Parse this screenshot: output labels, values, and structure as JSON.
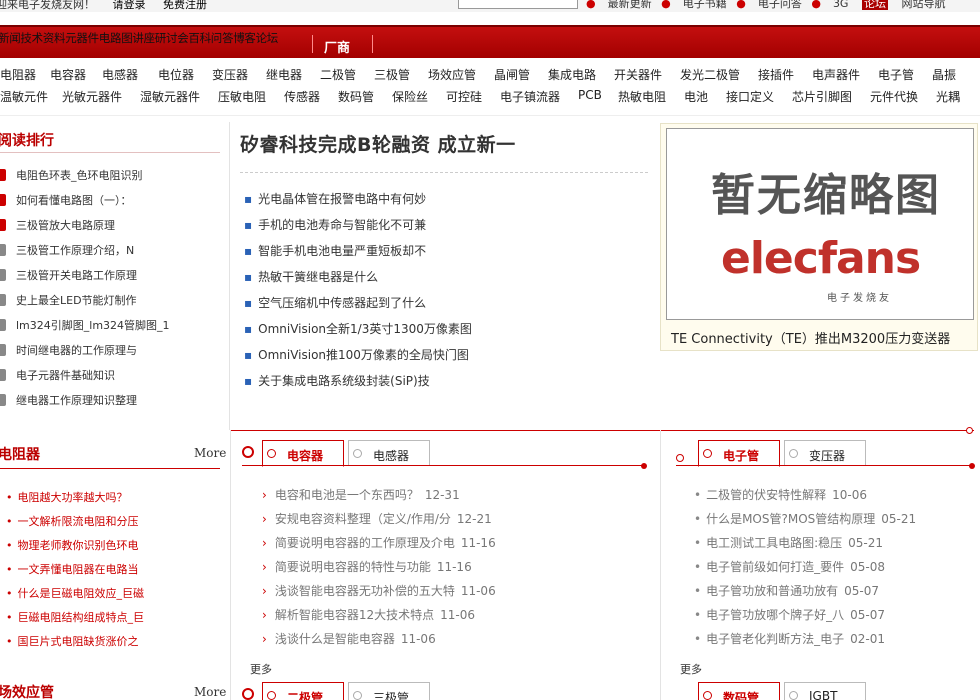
{
  "topbar": {
    "welcome": "迎来电子发烧友网！",
    "login": "请登录",
    "register": "免费注册",
    "links": [
      "最新更新",
      "电子书籍",
      "电子问答",
      "3G",
      "论坛",
      "网站导航"
    ]
  },
  "rednav": {
    "links": "新闻技术资料元器件电路图讲座研讨会百科问答博客论坛",
    "vendor": "厂商"
  },
  "categories": {
    "row1": [
      "电阻器",
      "电容器",
      "电感器",
      "电位器",
      "变压器",
      "继电器",
      "二极管",
      "三极管",
      "场效应管",
      "晶闸管",
      "集成电路",
      "开关器件",
      "发光二极管",
      "接插件",
      "电声器件",
      "电子管",
      "晶振"
    ],
    "row2": [
      "温敏元件",
      "光敏元器件",
      "湿敏元器件",
      "压敏电阻",
      "传感器",
      "数码管",
      "保险丝",
      "可控硅",
      "电子镇流器",
      "PCB",
      "热敏电阻",
      "电池",
      "接口定义",
      "芯片引脚图",
      "元件代换",
      "光耦"
    ]
  },
  "ranking": {
    "title": "阅读排行",
    "items": [
      "电阻色环表_色环电阻识别",
      "如何看懂电路图（一）：",
      "三极管放大电路原理",
      "三极管工作原理介绍，N",
      "三极管开关电路工作原理",
      "史上最全LED节能灯制作",
      "lm324引脚图_lm324管脚图_1",
      "时间继电器的工作原理与",
      "电子元器件基础知识",
      "继电器工作原理知识整理"
    ]
  },
  "headline": {
    "title": "矽睿科技完成B轮融资 成立新一",
    "news": [
      "光电晶体管在报警电路中有何妙",
      "手机的电池寿命与智能化不可兼",
      "智能手机电池电量严重短板却不",
      "热敏干簧继电器是什么",
      "空气压缩机中传感器起到了什么",
      "OmniVision全新1/3英寸1300万像素图",
      "OmniVision推100万像素的全局快门图",
      "关于集成电路系统级封装(SiP)技"
    ]
  },
  "feature": {
    "placeholder": "暂无缩略图",
    "logo": "elecfans",
    "logo_sub": "电子发烧友",
    "caption": "TE Connectivity（TE）推出M3200压力变送器"
  },
  "resistor_block": {
    "title": "电阻器",
    "more": "More",
    "items": [
      "电阻越大功率越大吗？",
      "一文解析限流电阻和分压",
      "物理老师教你识别色环电",
      "一文弄懂电阻器在电路当",
      "什么是巨磁电阻效应_巨磁",
      "巨磁电阻结构组成特点_巨",
      "国巨片式电阻缺货涨价之"
    ]
  },
  "fet_block": {
    "title": "场效应管",
    "more": "More"
  },
  "capacitor_tabs": {
    "tabs": [
      "电容器",
      "电感器"
    ],
    "items": [
      {
        "text": "电容和电池是一个东西吗？",
        "date": "12-31"
      },
      {
        "text": "安规电容资料整理（定义/作用/分",
        "date": "12-21"
      },
      {
        "text": "简要说明电容器的工作原理及介电",
        "date": "11-16"
      },
      {
        "text": "简要说明电容器的特性与功能",
        "date": "11-16"
      },
      {
        "text": "浅谈智能电容器无功补偿的五大特",
        "date": "11-06"
      },
      {
        "text": "解析智能电容器12大技术特点",
        "date": "11-06"
      },
      {
        "text": "浅谈什么是智能电容器",
        "date": "11-06"
      }
    ],
    "more": "更多"
  },
  "tube_tabs": {
    "tabs": [
      "电子管",
      "变压器"
    ],
    "items": [
      {
        "text": "二极管的伏安特性解释",
        "date": "10-06"
      },
      {
        "text": "什么是MOS管?MOS管结构原理",
        "date": "05-21"
      },
      {
        "text": "电工测试工具电路图:稳压",
        "date": "05-21"
      },
      {
        "text": "电子管前级如何打造_要件",
        "date": "05-08"
      },
      {
        "text": "电子管功放和普通功放有",
        "date": "05-07"
      },
      {
        "text": "电子管功放哪个牌子好_八",
        "date": "05-07"
      },
      {
        "text": "电子管老化判断方法_电子",
        "date": "02-01"
      }
    ],
    "more": "更多"
  },
  "bottom_tabs_left": {
    "tabs": [
      "二极管",
      "三极管"
    ]
  },
  "bottom_tabs_right": {
    "tabs": [
      "数码管",
      "IGBT"
    ]
  }
}
